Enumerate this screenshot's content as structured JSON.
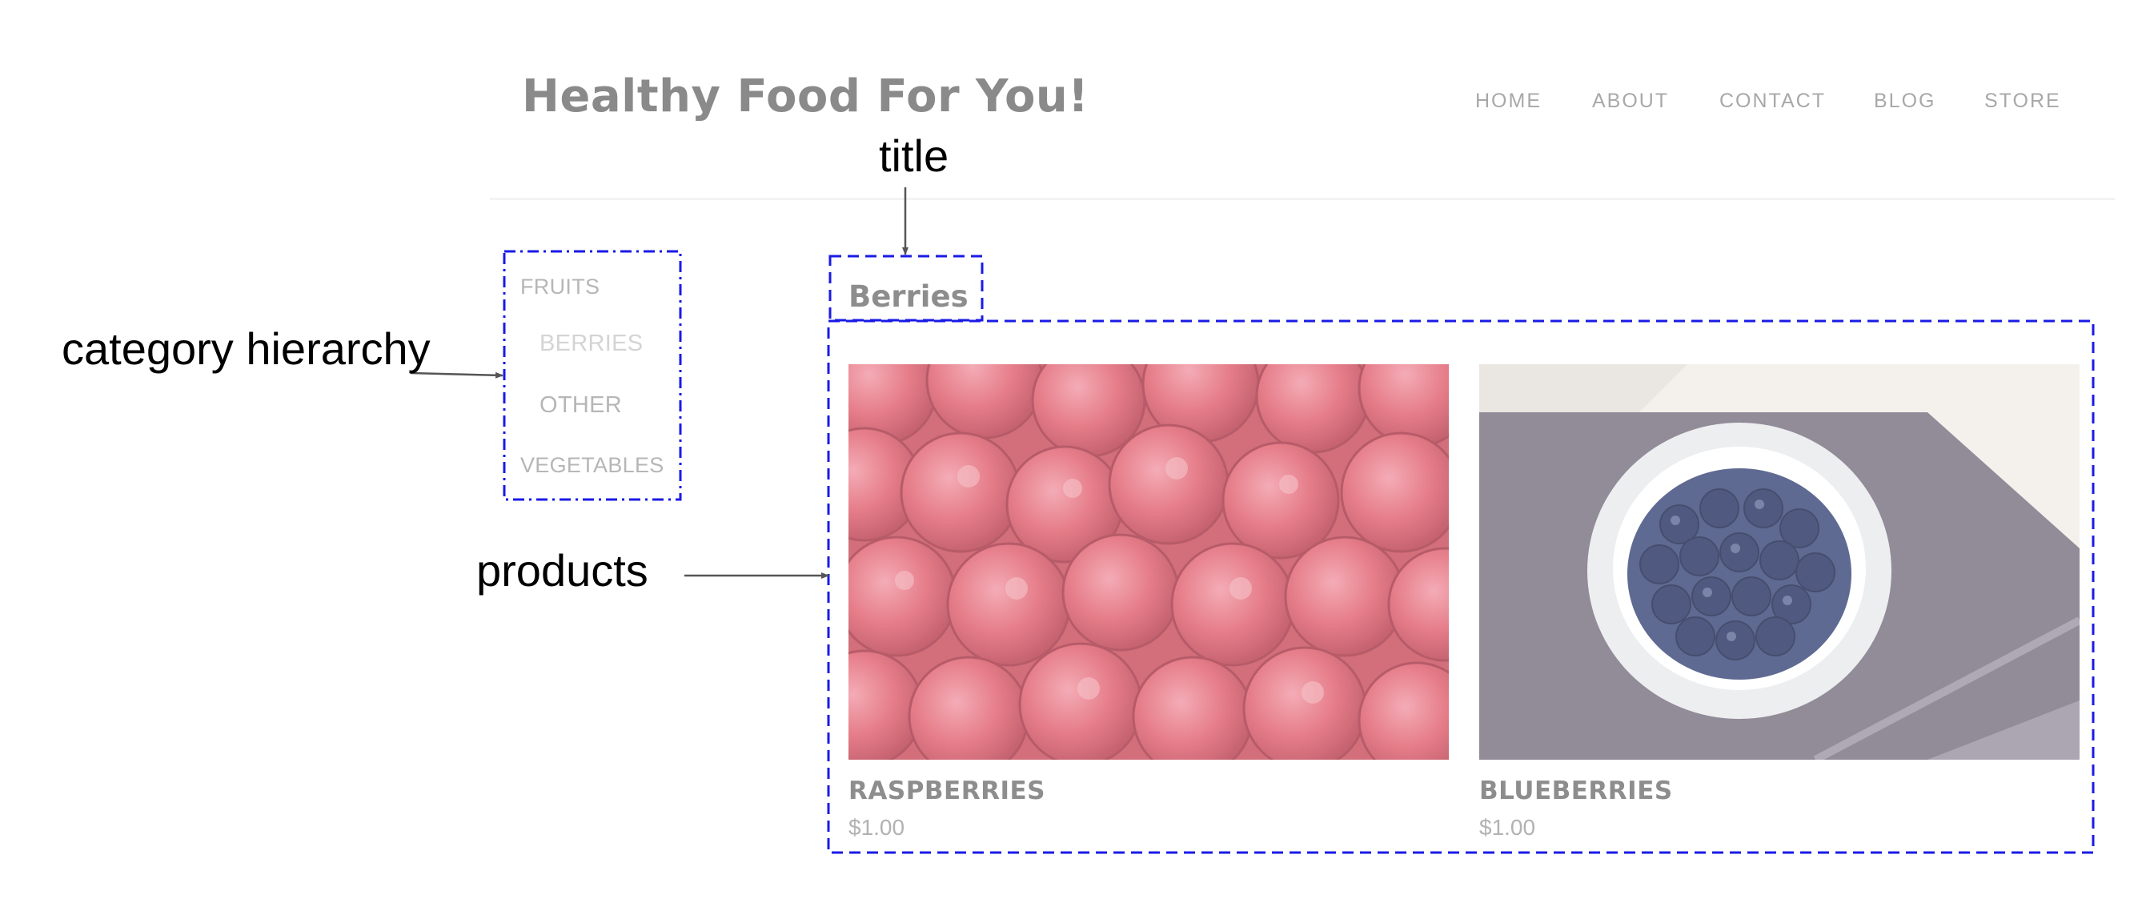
{
  "header": {
    "site_title": "Healthy Food For You!",
    "nav": [
      "HOME",
      "ABOUT",
      "CONTACT",
      "BLOG",
      "STORE"
    ]
  },
  "sidebar": {
    "categories": [
      {
        "label": "FRUITS",
        "level": 0
      },
      {
        "label": "BERRIES",
        "level": 1,
        "active": true
      },
      {
        "label": "OTHER",
        "level": 1
      },
      {
        "label": "VEGETABLES",
        "level": 0
      }
    ]
  },
  "main": {
    "section_title": "Berries",
    "products": [
      {
        "name": "RASPBERRIES",
        "price": "$1.00",
        "image": "raspberries-photo"
      },
      {
        "name": "BLUEBERRIES",
        "price": "$1.00",
        "image": "blueberries-photo"
      }
    ]
  },
  "annotations": {
    "title": "title",
    "category_hierarchy": "category hierarchy",
    "products": "products",
    "box_color": "#1a1ae6"
  }
}
